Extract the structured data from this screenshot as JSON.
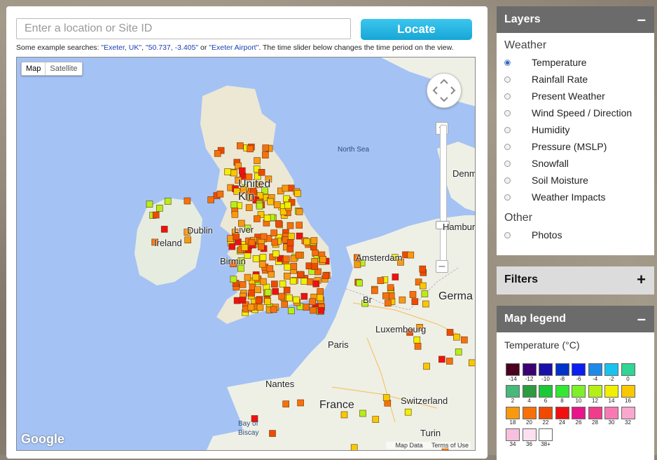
{
  "search": {
    "placeholder": "Enter a location or Site ID",
    "locate_label": "Locate",
    "hint_prefix": "Some example searches: ",
    "example1": "\"Exeter, UK\"",
    "sep1": ", ",
    "example2": "\"50.737, -3.405\"",
    "sep2": " or ",
    "example3": "\"Exeter Airport\"",
    "hint_suffix": ". The time slider below changes the time period on the view."
  },
  "map": {
    "type_map": "Map",
    "type_satellite": "Satellite",
    "labels": {
      "north_sea": "North Sea",
      "united": "United",
      "kingdom": "Kin",
      "dublin": "Dublin",
      "ireland": "Ireland",
      "liverpool": "Liver",
      "birmingham": "Birmin",
      "amsterdam": "Amsterdam",
      "hamburg": "Hamburg",
      "denmark": "Denmark",
      "germany": "Germa",
      "luxembourg": "Luxembourg",
      "paris": "Paris",
      "nantes": "Nantes",
      "france": "France",
      "switzerland": "Switzerland",
      "turin": "Turin",
      "bay": "Bay of",
      "biscay": "Biscay",
      "brussels": "Br"
    },
    "logo": "Google",
    "footer_data": "Map Data",
    "footer_terms": "Terms of Use"
  },
  "layers": {
    "title": "Layers",
    "toggle": "–",
    "weather_title": "Weather",
    "weather_items": [
      {
        "label": "Temperature",
        "checked": true
      },
      {
        "label": "Rainfall Rate",
        "checked": false
      },
      {
        "label": "Present Weather",
        "checked": false
      },
      {
        "label": "Wind Speed / Direction",
        "checked": false
      },
      {
        "label": "Humidity",
        "checked": false
      },
      {
        "label": "Pressure (MSLP)",
        "checked": false
      },
      {
        "label": "Snowfall",
        "checked": false
      },
      {
        "label": "Soil Moisture",
        "checked": false
      },
      {
        "label": "Weather Impacts",
        "checked": false
      }
    ],
    "other_title": "Other",
    "other_items": [
      {
        "label": "Photos",
        "checked": false
      }
    ]
  },
  "filters": {
    "title": "Filters",
    "toggle": "+"
  },
  "legend": {
    "title": "Map legend",
    "toggle": "–",
    "subtitle": "Temperature (°C)",
    "entries": [
      {
        "label": "-14",
        "color": "#4a0020"
      },
      {
        "label": "-12",
        "color": "#3b0073"
      },
      {
        "label": "-10",
        "color": "#1b0fa8"
      },
      {
        "label": "-8",
        "color": "#0033c9"
      },
      {
        "label": "-6",
        "color": "#0a1ff0"
      },
      {
        "label": "-4",
        "color": "#1e8ae8"
      },
      {
        "label": "-2",
        "color": "#19c3ee"
      },
      {
        "label": "0",
        "color": "#2fd696"
      },
      {
        "label": "2",
        "color": "#47b97a"
      },
      {
        "label": "4",
        "color": "#2d9b3f"
      },
      {
        "label": "6",
        "color": "#1bc836"
      },
      {
        "label": "8",
        "color": "#32e832"
      },
      {
        "label": "10",
        "color": "#7ef02a"
      },
      {
        "label": "12",
        "color": "#b4f018"
      },
      {
        "label": "14",
        "color": "#f0f000"
      },
      {
        "label": "16",
        "color": "#f8c800"
      },
      {
        "label": "18",
        "color": "#f89a10"
      },
      {
        "label": "20",
        "color": "#f8700a"
      },
      {
        "label": "22",
        "color": "#f04a00"
      },
      {
        "label": "24",
        "color": "#f01010"
      },
      {
        "label": "26",
        "color": "#e8148a"
      },
      {
        "label": "28",
        "color": "#f03c8a"
      },
      {
        "label": "30",
        "color": "#f87ab4"
      },
      {
        "label": "32",
        "color": "#f8a8cf"
      },
      {
        "label": "34",
        "color": "#f8c0df"
      },
      {
        "label": "36",
        "color": "#fbe0ef"
      },
      {
        "label": "38+",
        "color": "#ffffff"
      }
    ]
  }
}
